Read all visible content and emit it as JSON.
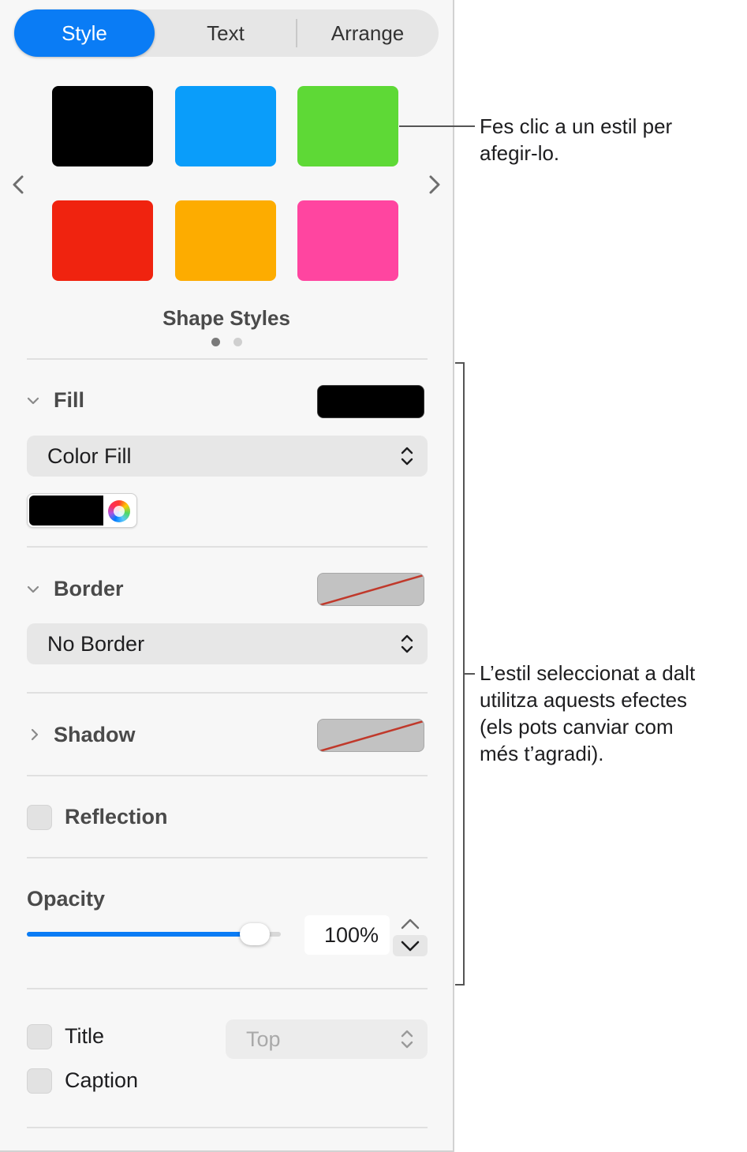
{
  "tabs": [
    {
      "label": "Style",
      "selected": true
    },
    {
      "label": "Text",
      "selected": false
    },
    {
      "label": "Arrange",
      "selected": false
    }
  ],
  "shape_styles": {
    "label": "Shape Styles",
    "swatches": [
      "#000000",
      "#0a9dfa",
      "#5ed936",
      "#f0230f",
      "#fdac00",
      "#ff45a0"
    ],
    "page_count": 2,
    "current_page": 1
  },
  "fill": {
    "label": "Fill",
    "expanded": true,
    "well_color": "#000000",
    "type_value": "Color Fill",
    "color": "#000000"
  },
  "border": {
    "label": "Border",
    "expanded": true,
    "type_value": "No Border"
  },
  "shadow": {
    "label": "Shadow",
    "expanded": false
  },
  "reflection": {
    "label": "Reflection",
    "checked": false
  },
  "opacity": {
    "label": "Opacity",
    "value_text": "100%",
    "fraction": 1.0
  },
  "title": {
    "label": "Title",
    "checked": false,
    "position_value": "Top"
  },
  "caption": {
    "label": "Caption",
    "checked": false
  },
  "callouts": {
    "styles": [
      "Fes clic a un estil per",
      "afegir-lo."
    ],
    "effects": [
      "L’estil seleccionat a dalt",
      "utilitza aquests efectes",
      "(els pots canviar com",
      "més t’agradi)."
    ]
  },
  "colors": {
    "accent": "#0a7cf5",
    "no_line_red": "#c0392b"
  },
  "icons": [
    "chevron-left-icon",
    "chevron-right-icon",
    "chevron-down-icon",
    "chevron-right-icon",
    "up-down-chevron-icon",
    "color-wheel-icon",
    "stepper-up-icon",
    "stepper-down-icon"
  ]
}
